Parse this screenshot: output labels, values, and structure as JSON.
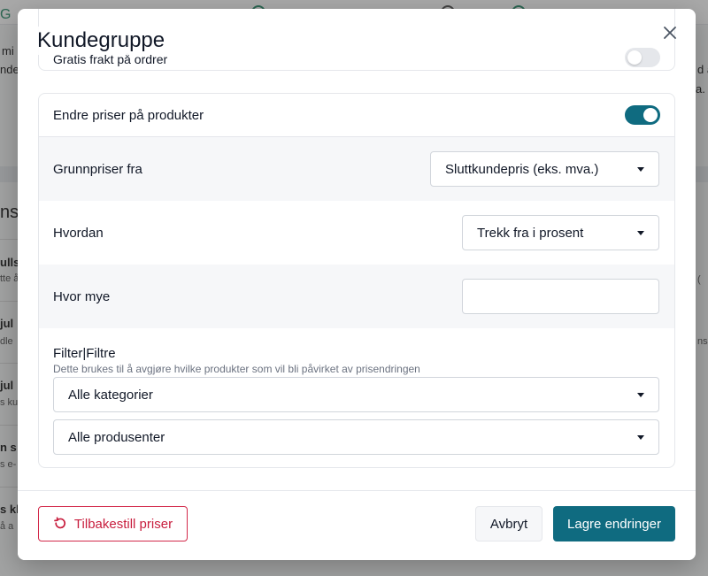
{
  "background": {
    "fragments": [
      "mi",
      "nde",
      "nsi",
      "ullst",
      "tte å",
      "jul",
      "dle",
      "jul",
      "s ku",
      "n s",
      "s e-",
      "s kl",
      "å a",
      "d a",
      "a.",
      "ns",
      "(",
      "G"
    ]
  },
  "modal": {
    "title": "Kundegruppe",
    "previous_option_label": "Gratis frakt på ordrer",
    "price_change": {
      "label": "Endre priser på produkter",
      "enabled": true,
      "base_prices_label": "Grunnpriser fra",
      "base_prices_value": "Sluttkundepris (eks. mva.)",
      "method_label": "Hvordan",
      "method_value": "Trekk fra i prosent",
      "amount_label": "Hvor mye",
      "amount_value": ""
    },
    "filter": {
      "title": "Filter|Filtre",
      "description": "Dette brukes til å avgjøre hvilke produkter som vil bli påvirket av prisendringen",
      "category_value": "Alle kategorier",
      "manufacturer_value": "Alle produsenter"
    },
    "footer": {
      "reset_label": "Tilbakestill priser",
      "cancel_label": "Avbryt",
      "save_label": "Lagre endringer"
    }
  },
  "colors": {
    "primary": "#0f6b80",
    "danger": "#c81e3e",
    "border": "#e5e7eb",
    "shaded_row": "#f6f7f9"
  },
  "icons": {
    "close": "close-icon",
    "reset": "refresh-icon",
    "dropdown": "caret-down-icon"
  }
}
